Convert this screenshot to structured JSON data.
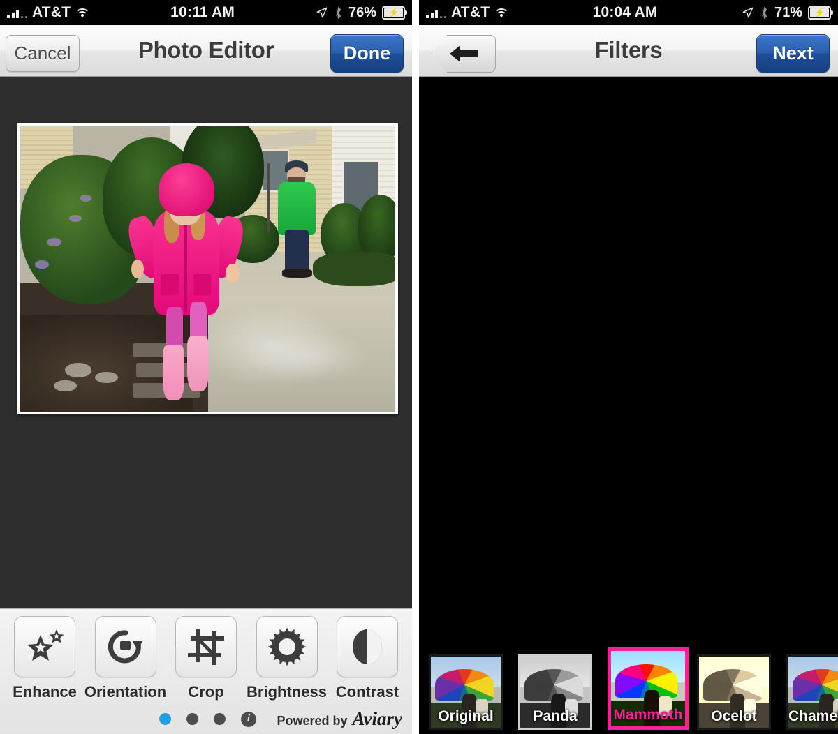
{
  "left_panel": {
    "status_bar": {
      "carrier": "AT&T",
      "time": "10:11 AM",
      "battery_pct": "76%",
      "signal_icon": "signal-bars-icon",
      "wifi_icon": "wifi-icon",
      "location_icon": "location-arrow-icon",
      "bluetooth_icon": "bluetooth-icon",
      "battery_icon": "battery-charging-icon"
    },
    "nav": {
      "title": "Photo Editor",
      "cancel_label": "Cancel",
      "done_label": "Done"
    },
    "tools": [
      {
        "label": "Enhance",
        "icon": "stars-icon"
      },
      {
        "label": "Orientation",
        "icon": "rotate-icon"
      },
      {
        "label": "Crop",
        "icon": "crop-icon"
      },
      {
        "label": "Brightness",
        "icon": "sun-icon"
      },
      {
        "label": "Contrast",
        "icon": "contrast-circle-icon"
      }
    ],
    "pager": {
      "total_dots": 3,
      "active_index": 0,
      "info_label": "i"
    },
    "footer": {
      "powered_by": "Powered by",
      "brand": "Aviary"
    }
  },
  "right_panel": {
    "status_bar": {
      "carrier": "AT&T",
      "time": "10:04 AM",
      "battery_pct": "71%",
      "signal_icon": "signal-bars-icon",
      "wifi_icon": "wifi-icon",
      "location_icon": "location-arrow-icon",
      "bluetooth_icon": "bluetooth-icon",
      "battery_icon": "battery-charging-icon"
    },
    "nav": {
      "title": "Filters",
      "back_icon": "back-arrow-icon",
      "next_label": "Next"
    },
    "filters": [
      {
        "label": "Original",
        "style": "original",
        "selected": false
      },
      {
        "label": "Panda",
        "style": "gray",
        "selected": false
      },
      {
        "label": "Mammoth",
        "style": "vivid",
        "selected": true
      },
      {
        "label": "Ocelot",
        "style": "sepia",
        "selected": false
      },
      {
        "label": "Chameleon",
        "style": "original",
        "selected": false
      }
    ],
    "selected_filter": "Mammoth",
    "accent_color": "#f72196"
  }
}
